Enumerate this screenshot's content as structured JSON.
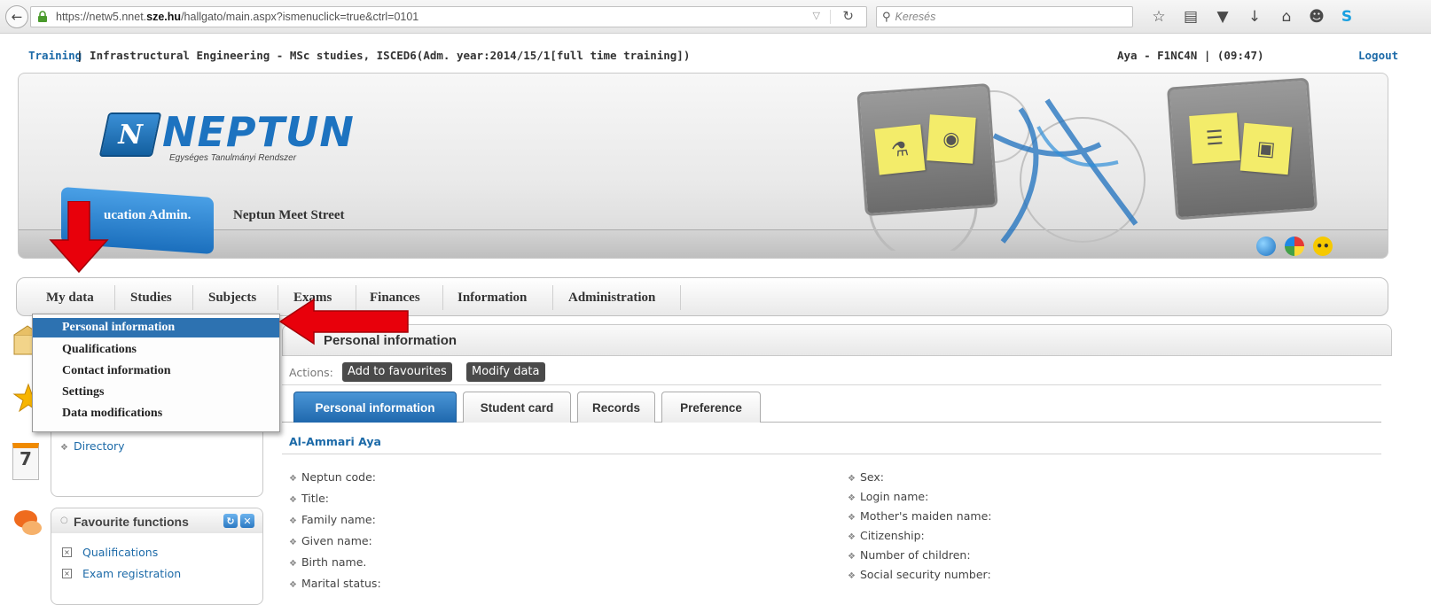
{
  "browser": {
    "url_prefix": "https://netw5.nnet.",
    "url_domain": "sze.hu",
    "url_suffix": "/hallgato/main.aspx?ismenuclick=true&ctrl=0101",
    "search_placeholder": "Keresés"
  },
  "info_line": {
    "training_link": "Training",
    "training_text": "|  Infrastructural Engineering - MSc studies, ISCED6(Adm. year:2014/15/1[full time training])",
    "user_text": "Aya - F1NC4N  |  (09:47)",
    "logout": "Logout"
  },
  "header": {
    "logo_title": "NEPTUN",
    "logo_subtitle": "Egységes Tanulmányi Rendszer",
    "portal_tab": "ucation Admin.",
    "meet_street": "Neptun Meet Street"
  },
  "menu": {
    "items": [
      "My data",
      "Studies",
      "Subjects",
      "Exams",
      "Finances",
      "Information",
      "Administration"
    ]
  },
  "dropdown": {
    "items": [
      "Personal information",
      "Qualifications",
      "Contact information",
      "Settings",
      "Data modifications"
    ],
    "active_index": 0
  },
  "sidebar": {
    "directory_link": "Directory",
    "calendar_day": "7",
    "favourites_title": "Favourite functions",
    "favourites": [
      "Qualifications",
      "Exam registration"
    ]
  },
  "content": {
    "title": "Personal information",
    "actions_label": "Actions:",
    "actions": [
      "Add to favourites",
      "Modify data"
    ],
    "tabs": [
      "Personal information",
      "Student card",
      "Records",
      "Preference"
    ],
    "student_name": "Al-Ammari Aya",
    "fields_left": [
      "Neptun code:",
      "Title:",
      "Family name:",
      "Given name:",
      "Birth name.",
      "Marital status:"
    ],
    "fields_right": [
      "Sex:",
      "Login name:",
      "Mother's maiden name:",
      "Citizenship:",
      "Number of children:",
      "Social security number:"
    ]
  },
  "colors": {
    "link_blue": "#1c6aa8",
    "active_blue": "#2d72b1",
    "arrow_red": "#e8000b"
  }
}
